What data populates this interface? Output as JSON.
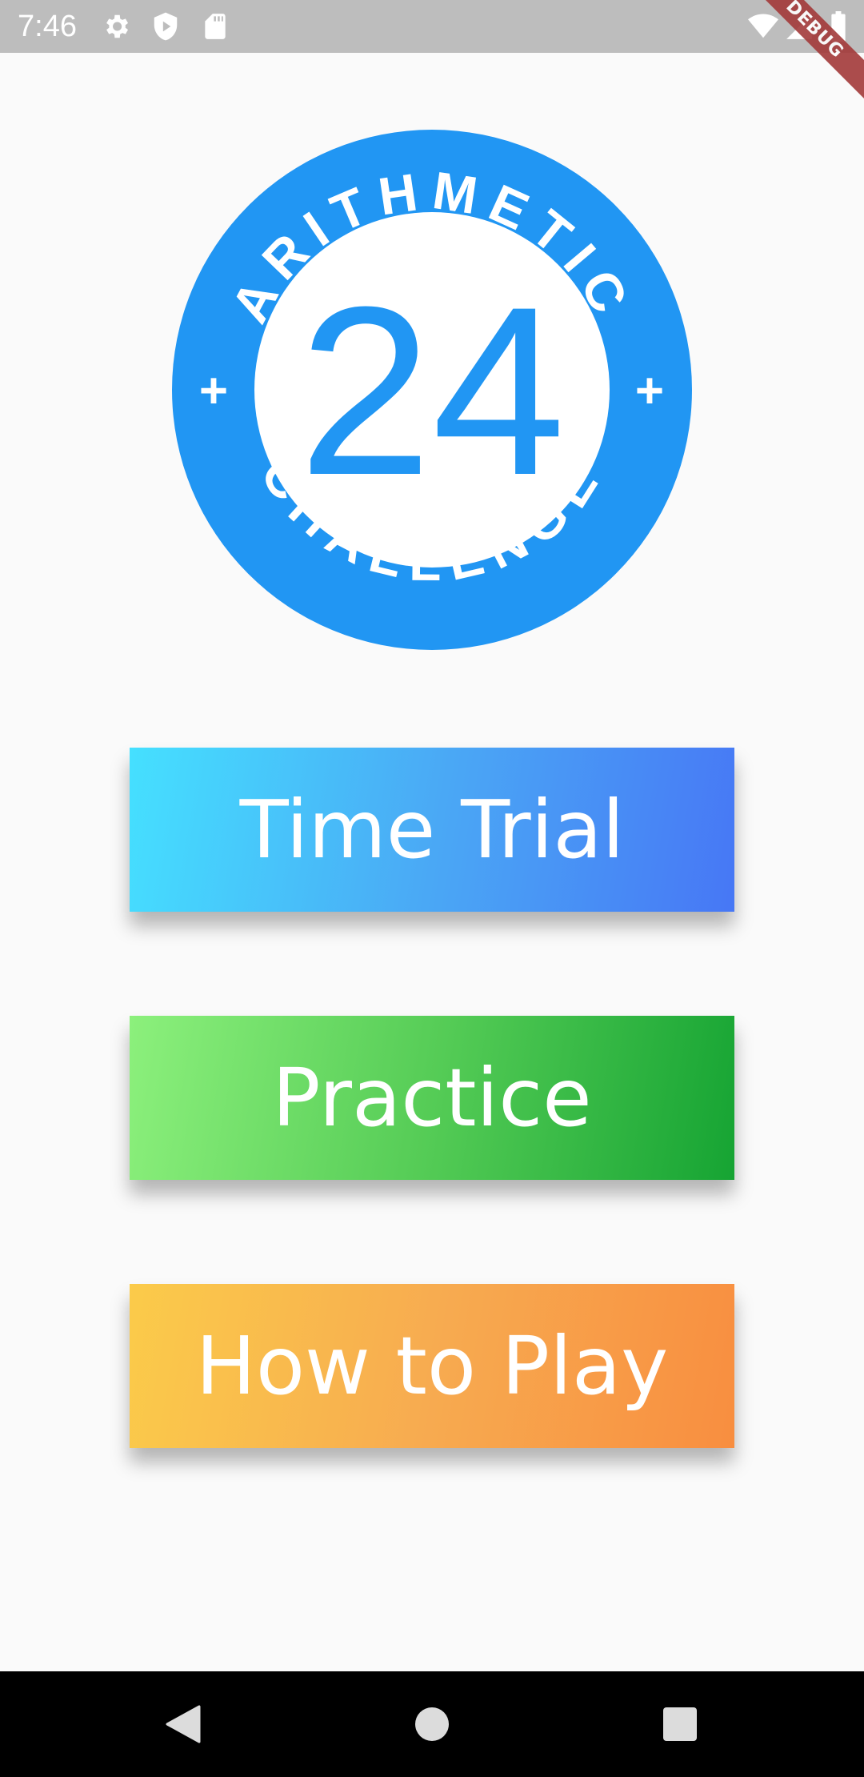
{
  "status_bar": {
    "time": "7:46",
    "icons": [
      "settings-icon",
      "shield-play-icon",
      "sd-card-icon",
      "wifi-icon",
      "signal-icon",
      "battery-icon"
    ],
    "debug_label": "DEBUG"
  },
  "logo": {
    "top_text": "ARITHMETIC",
    "bottom_text": "CHALLENGE",
    "number": "24",
    "left_symbol": "+",
    "right_symbol": "+",
    "color": "#2196f3"
  },
  "menu": {
    "time_trial_label": "Time Trial",
    "practice_label": "Practice",
    "how_to_play_label": "How to Play"
  },
  "nav_bar": {
    "icons": [
      "back-icon",
      "home-icon",
      "recents-icon"
    ]
  }
}
